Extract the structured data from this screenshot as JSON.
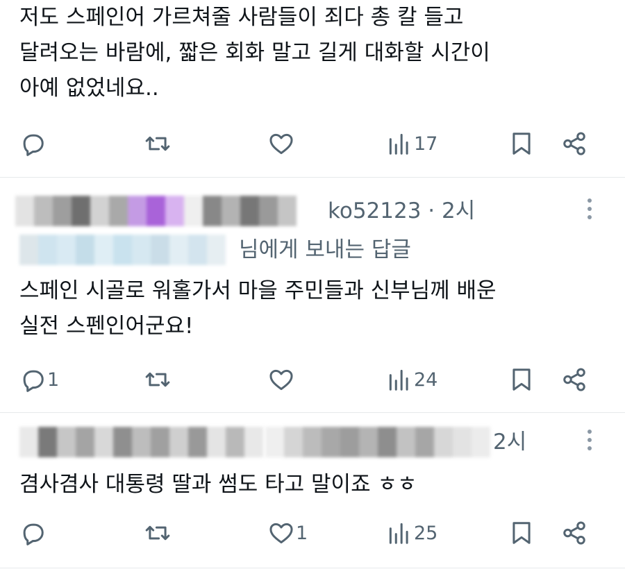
{
  "tweets": [
    {
      "text": "저도 스페인어 가르쳐줄 사람들이 죄다 총 칼 들고\n달려오는 바람에, 짧은 회화 말고 길게 대화할 시간이\n아예 없었네요..",
      "actions": {
        "reply_count": "",
        "repost_count": "",
        "like_count": "",
        "view_count": "17"
      }
    },
    {
      "handle_time": "ko52123 · 2시",
      "reply_to": "님에게 보내는 답글",
      "text": "스페인 시골로 워홀가서 마을 주민들과 신부님께 배운\n실전 스펜인어군요!",
      "actions": {
        "reply_count": "1",
        "repost_count": "",
        "like_count": "",
        "view_count": "24"
      }
    },
    {
      "handle_time": "2시",
      "text": "겸사겸사 대통령 딸과 썸도 타고 말이죠 ㅎㅎ",
      "actions": {
        "reply_count": "",
        "repost_count": "",
        "like_count": "1",
        "view_count": "25"
      }
    }
  ],
  "icons": {
    "reply": "reply-icon",
    "repost": "repost-icon",
    "like": "heart-icon",
    "views": "views-icon",
    "bookmark": "bookmark-icon",
    "share": "share-icon",
    "more": "more-icon"
  },
  "colors": {
    "text": "#0f1419",
    "secondary": "#536471",
    "divider": "#e6e9eb"
  }
}
